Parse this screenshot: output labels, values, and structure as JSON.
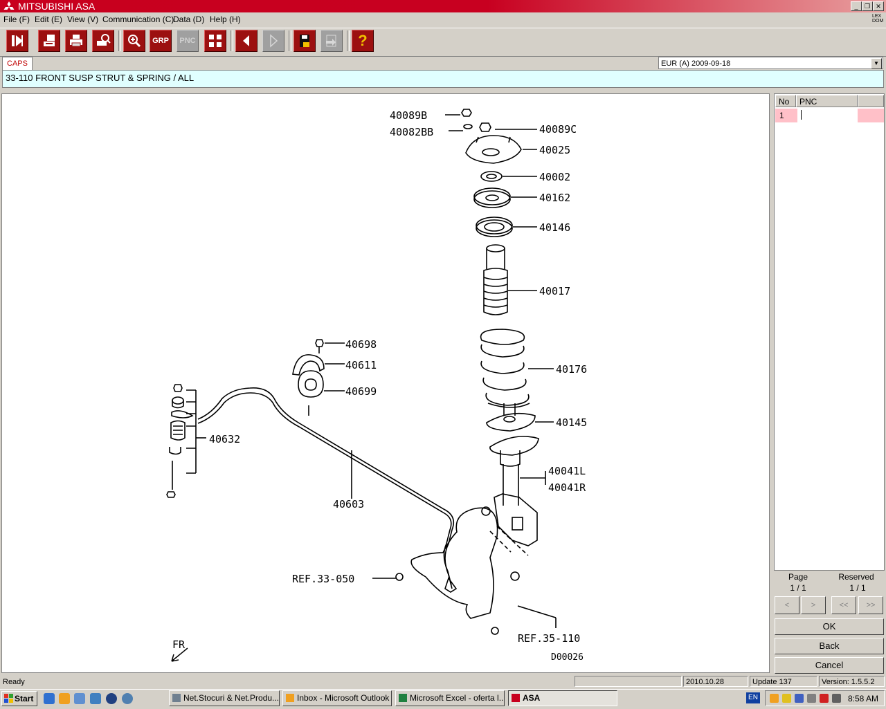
{
  "window": {
    "title": "MITSUBISHI ASA",
    "min_label": "_",
    "restore_label": "❐",
    "close_label": "✕"
  },
  "menu": [
    "File (F)",
    "Edit (E)",
    "View (V)",
    "Communication (C)",
    "Data (D)",
    "Help (H)"
  ],
  "toolbar": {
    "grp_label": "GRP",
    "pnc_label": "PNC",
    "help_label": "?",
    "lex_label": "LEX\nDOM"
  },
  "tab": {
    "caps": "CAPS"
  },
  "region": {
    "value": "EUR (A)   2009-09-18"
  },
  "breadcrumb": "33-110  FRONT SUSP STRUT & SPRING / ALL",
  "drawing": {
    "labels": {
      "p40089B": "40089B",
      "p40082BB": "40082BB",
      "p40089C": "40089C",
      "p40025": "40025",
      "p40002": "40002",
      "p40162": "40162",
      "p40146": "40146",
      "p40017": "40017",
      "p40698": "40698",
      "p40611": "40611",
      "p40699": "40699",
      "p40176": "40176",
      "p40145": "40145",
      "p40632": "40632",
      "p40041L": "40041L",
      "p40041R": "40041R",
      "p40603": "40603",
      "ref33": "REF.33-050",
      "ref35": "REF.35-110",
      "fr": "FR",
      "code": "D00026"
    }
  },
  "right_panel": {
    "col_no": "No",
    "col_pnc": "PNC",
    "row1_no": "1",
    "page_label": "Page",
    "page_value": "1 / 1",
    "reserved_label": "Reserved",
    "reserved_value": "1 / 1",
    "nav": [
      "<",
      ">",
      "<<",
      ">>"
    ],
    "ok": "OK",
    "back": "Back",
    "cancel": "Cancel"
  },
  "status": {
    "ready": "Ready",
    "date": "2010.10.28",
    "update": "Update 137",
    "version": "Version: 1.5.5.2"
  },
  "taskbar": {
    "start": "Start",
    "tasks": [
      "Net.Stocuri & Net.Produ...",
      "Inbox - Microsoft Outlook",
      "Microsoft Excel - oferta l...",
      "ASA"
    ],
    "lang": "EN",
    "clock": "8:58 AM"
  },
  "colors": {
    "title_red": "#c8001e",
    "toolbar_button": "#9c1010",
    "breadcrumb_bg": "#e0ffff",
    "selected_row": "#ffc0c8"
  }
}
